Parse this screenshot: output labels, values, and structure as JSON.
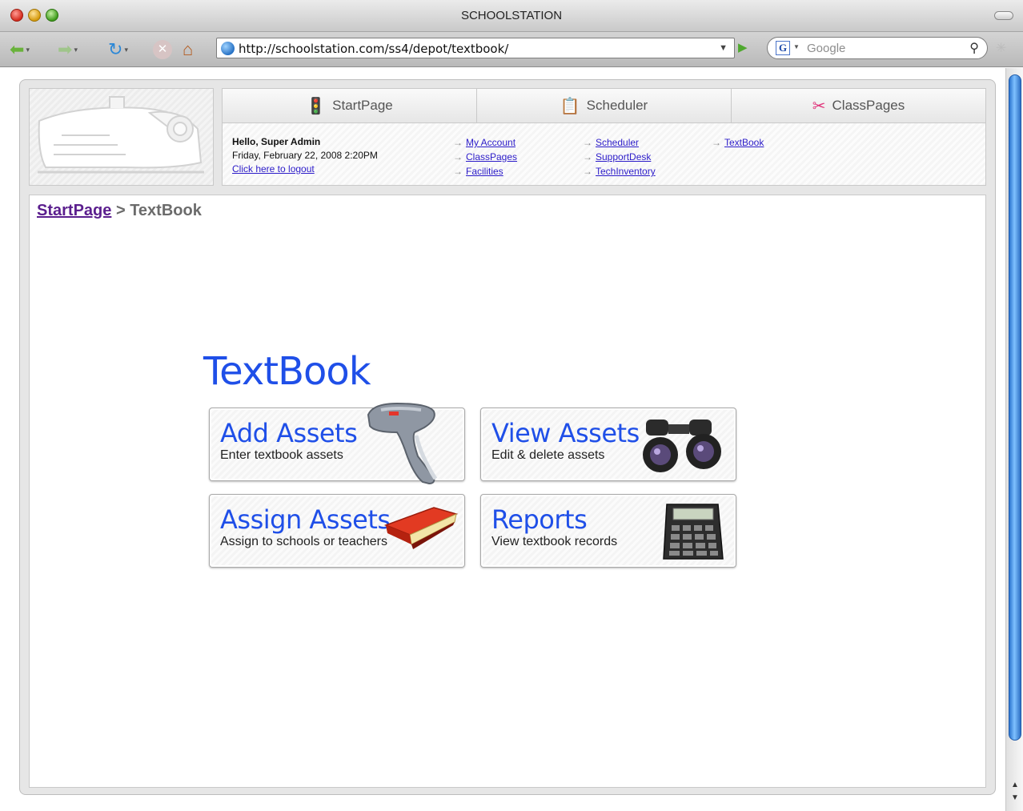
{
  "window": {
    "title": "SCHOOLSTATION"
  },
  "toolbar": {
    "url": "http://schoolstation.com/ss4/depot/textbook/",
    "search_placeholder": "Google",
    "search_engine_letter": "G"
  },
  "tabs": [
    {
      "label": "StartPage",
      "icon": "traffic-light-icon"
    },
    {
      "label": "Scheduler",
      "icon": "clipboard-icon"
    },
    {
      "label": "ClassPages",
      "icon": "scissors-icon"
    }
  ],
  "user": {
    "greeting": "Hello, Super Admin",
    "datetime": "Friday, February 22, 2008 2:20PM",
    "logout": "Click here to logout"
  },
  "quick_links": [
    [
      "My Account",
      "ClassPages",
      "Facilities"
    ],
    [
      "Scheduler",
      "SupportDesk",
      "TechInventory"
    ],
    [
      "TextBook"
    ]
  ],
  "breadcrumb": {
    "root": "StartPage",
    "separator": ">",
    "current": "TextBook"
  },
  "heading": "TextBook",
  "cards": {
    "add": {
      "title": "Add Assets",
      "subtitle": "Enter textbook assets"
    },
    "view": {
      "title": "View Assets",
      "subtitle": "Edit & delete assets"
    },
    "assign": {
      "title": "Assign Assets",
      "subtitle": "Assign to schools or teachers"
    },
    "reports": {
      "title": "Reports",
      "subtitle": "View textbook records"
    }
  },
  "colors": {
    "heading_blue": "#1f4fe8",
    "link_blue": "#2c1cc9",
    "breadcrumb_purple": "#5b1f8e"
  }
}
